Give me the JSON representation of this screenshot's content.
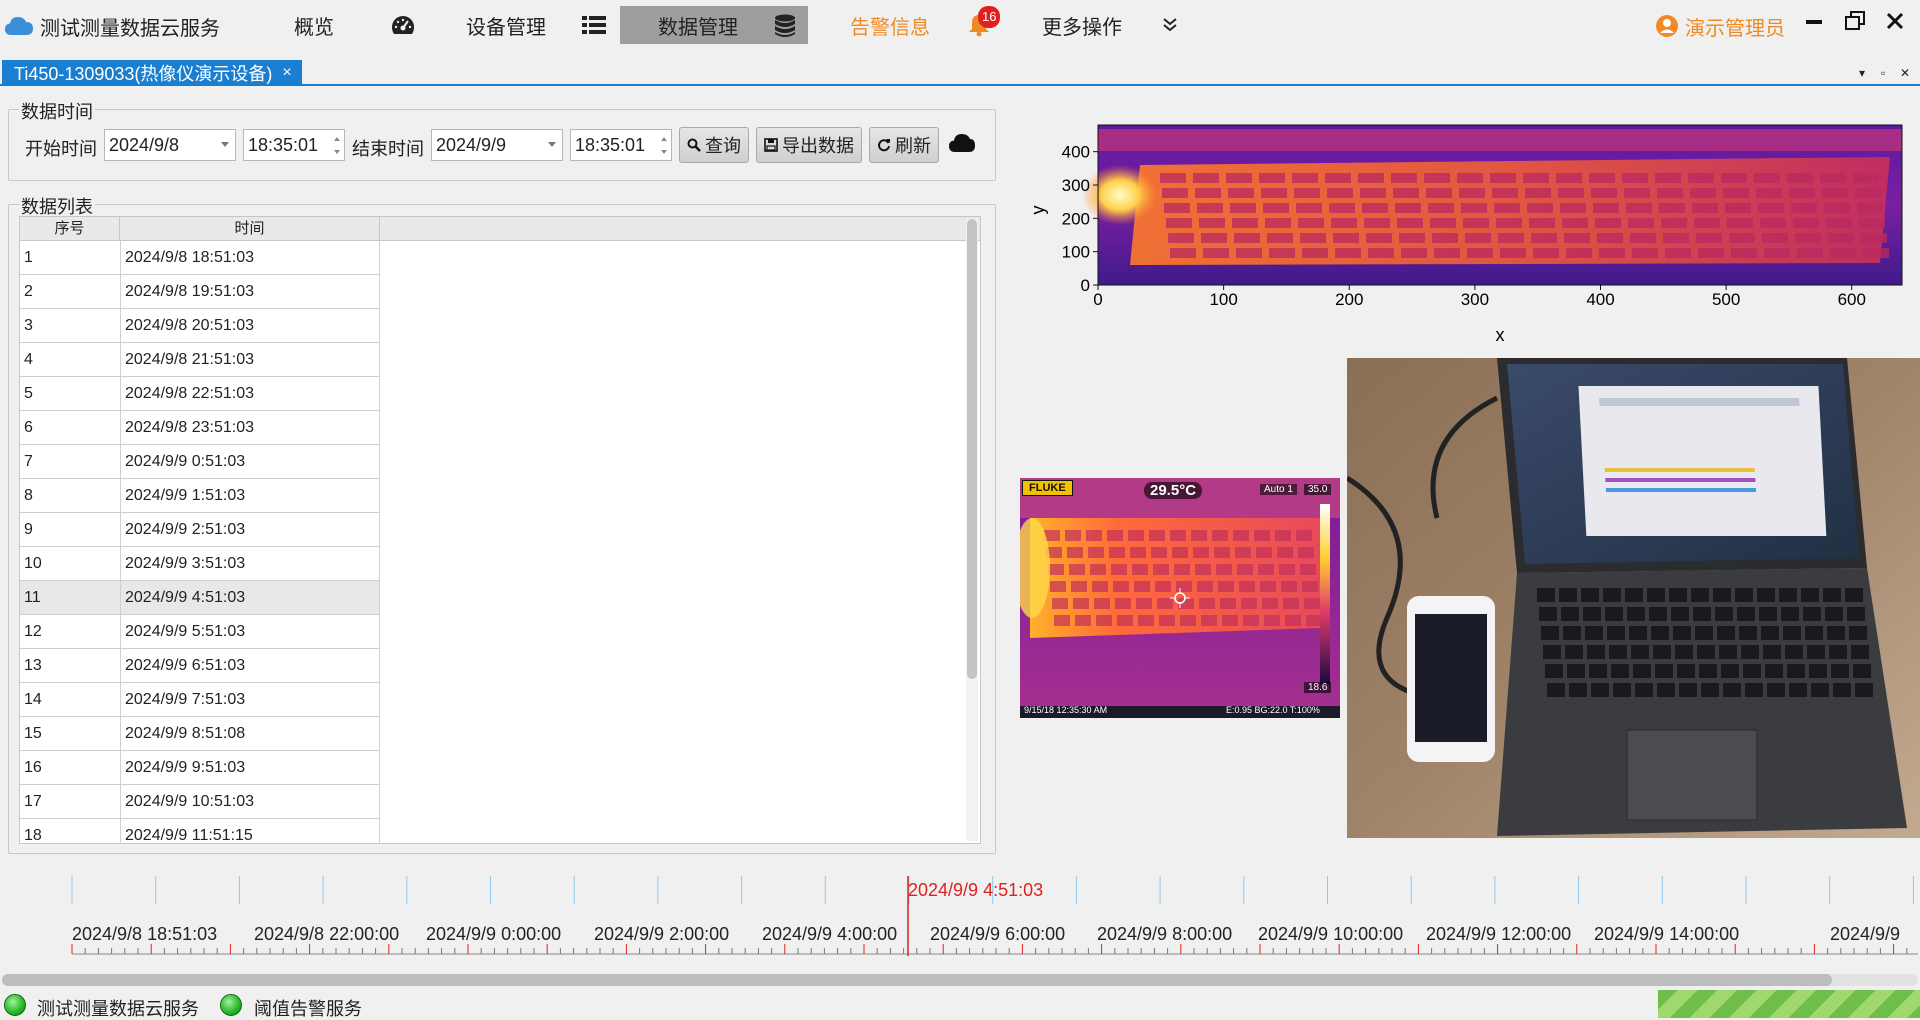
{
  "app": {
    "title": "测试测量数据云服务"
  },
  "nav": {
    "overview": "概览",
    "devices": "设备管理",
    "data": "数据管理",
    "alerts": "告警信息",
    "alert_count": "16",
    "more": "更多操作"
  },
  "user": {
    "name": "演示管理员"
  },
  "tab": {
    "label": "Ti450-1309033(热像仪演示设备)"
  },
  "time_group": {
    "title": "数据时间",
    "start_label": "开始时间",
    "start_date": "2024/9/8",
    "start_time": "18:35:01",
    "end_label": "结束时间",
    "end_date": "2024/9/9",
    "end_time": "18:35:01",
    "query": "查询",
    "export": "导出数据",
    "refresh": "刷新"
  },
  "list_group": {
    "title": "数据列表",
    "col_index": "序号",
    "col_time": "时间",
    "rows": [
      [
        "1",
        "2024/9/8 18:51:03"
      ],
      [
        "2",
        "2024/9/8 19:51:03"
      ],
      [
        "3",
        "2024/9/8 20:51:03"
      ],
      [
        "4",
        "2024/9/8 21:51:03"
      ],
      [
        "5",
        "2024/9/8 22:51:03"
      ],
      [
        "6",
        "2024/9/8 23:51:03"
      ],
      [
        "7",
        "2024/9/9 0:51:03"
      ],
      [
        "8",
        "2024/9/9 1:51:03"
      ],
      [
        "9",
        "2024/9/9 2:51:03"
      ],
      [
        "10",
        "2024/9/9 3:51:03"
      ],
      [
        "11",
        "2024/9/9 4:51:03"
      ],
      [
        "12",
        "2024/9/9 5:51:03"
      ],
      [
        "13",
        "2024/9/9 6:51:03"
      ],
      [
        "14",
        "2024/9/9 7:51:03"
      ],
      [
        "15",
        "2024/9/9 8:51:08"
      ],
      [
        "16",
        "2024/9/9 9:51:03"
      ],
      [
        "17",
        "2024/9/9 10:51:03"
      ],
      [
        "18",
        "2024/9/9 11:51:15"
      ]
    ],
    "selected_index": 10
  },
  "plot": {
    "xlabel": "x",
    "ylabel": "y",
    "xticks": [
      "0",
      "100",
      "200",
      "300",
      "400",
      "500",
      "600"
    ],
    "yticks": [
      "0",
      "100",
      "200",
      "300",
      "400"
    ],
    "xlim": [
      0,
      640
    ],
    "ylim": [
      0,
      480
    ]
  },
  "thermal": {
    "brand": "FLUKE",
    "temp": "29.5°C",
    "mode": "Auto 1",
    "max": "35.0",
    "min": "18.6",
    "timestamp": "9/15/18 12:35:30 AM",
    "params": "E:0.95 BG:22.0 T:100%"
  },
  "timeline": {
    "current": "2024/9/9 4:51:03",
    "labels": [
      "2024/9/8 18:51:03",
      "2024/9/8 22:00:00",
      "2024/9/9 0:00:00",
      "2024/9/9 2:00:00",
      "2024/9/9 4:00:00",
      "2024/9/9 6:00:00",
      "2024/9/9 8:00:00",
      "2024/9/9 10:00:00",
      "2024/9/9 12:00:00",
      "2024/9/9 14:00:00",
      "2024/9/9"
    ]
  },
  "status": {
    "service1": "测试测量数据云服务",
    "service2": "阈值告警服务"
  },
  "colors": {
    "accent": "#1a7fd1",
    "alert": "#f08a24",
    "badge": "#e0201f",
    "ok": "#25b525"
  }
}
